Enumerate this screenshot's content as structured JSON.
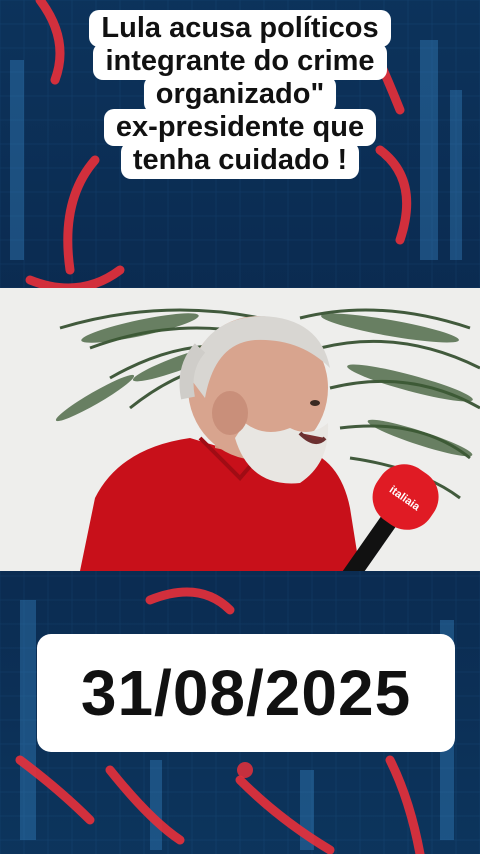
{
  "caption": {
    "lines": [
      "Lula acusa políticos",
      "integrante do crime",
      "organizado\"",
      "ex-presidente que",
      "tenha cuidado !"
    ]
  },
  "date_label": "31/08/2025",
  "microphone_logo": "italiaia",
  "colors": {
    "background_blue": "#0b2a4e",
    "neon_red": "#e8303a",
    "shirt_red": "#c8101a",
    "caption_bg": "#ffffff"
  }
}
